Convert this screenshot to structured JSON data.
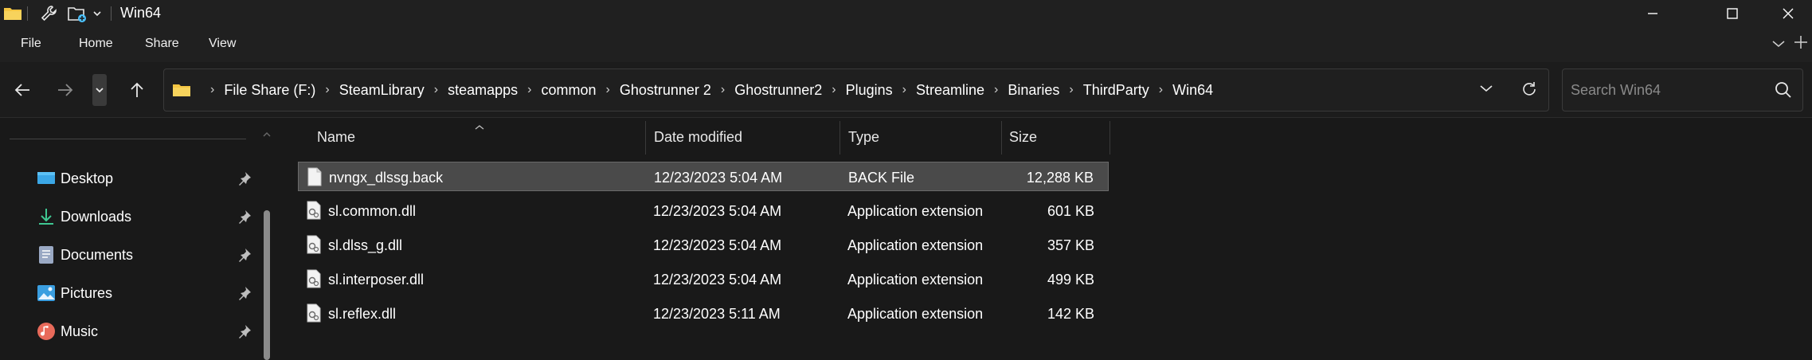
{
  "window": {
    "title": "Win64"
  },
  "ribbon": {
    "tabs": [
      "File",
      "Home",
      "Share",
      "View"
    ]
  },
  "address_bar": {
    "crumbs": [
      "File Share (F:)",
      "SteamLibrary",
      "steamapps",
      "common",
      "Ghostrunner 2",
      "Ghostrunner2",
      "Plugins",
      "Streamline",
      "Binaries",
      "ThirdParty",
      "Win64"
    ]
  },
  "search": {
    "placeholder": "Search Win64"
  },
  "sidebar": {
    "items": [
      {
        "label": "Desktop",
        "icon": "desktop-icon"
      },
      {
        "label": "Downloads",
        "icon": "download-icon"
      },
      {
        "label": "Documents",
        "icon": "document-icon"
      },
      {
        "label": "Pictures",
        "icon": "pictures-icon"
      },
      {
        "label": "Music",
        "icon": "music-icon"
      }
    ]
  },
  "columns": {
    "name": "Name",
    "date": "Date modified",
    "type": "Type",
    "size": "Size"
  },
  "files": [
    {
      "name": "nvngx_dlssg.back",
      "date": "12/23/2023 5:04 AM",
      "type": "BACK File",
      "size": "12,288 KB",
      "icon": "file-icon"
    },
    {
      "name": "sl.common.dll",
      "date": "12/23/2023 5:04 AM",
      "type": "Application extension",
      "size": "601 KB",
      "icon": "dll-icon"
    },
    {
      "name": "sl.dlss_g.dll",
      "date": "12/23/2023 5:04 AM",
      "type": "Application extension",
      "size": "357 KB",
      "icon": "dll-icon"
    },
    {
      "name": "sl.interposer.dll",
      "date": "12/23/2023 5:04 AM",
      "type": "Application extension",
      "size": "499 KB",
      "icon": "dll-icon"
    },
    {
      "name": "sl.reflex.dll",
      "date": "12/23/2023 5:11 AM",
      "type": "Application extension",
      "size": "142 KB",
      "icon": "dll-icon"
    }
  ],
  "colors": {
    "background": "#191919",
    "chrome": "#202020",
    "selection": "#4a4a4a",
    "folder": "#f4c542",
    "accent": "#4cc2ff"
  }
}
